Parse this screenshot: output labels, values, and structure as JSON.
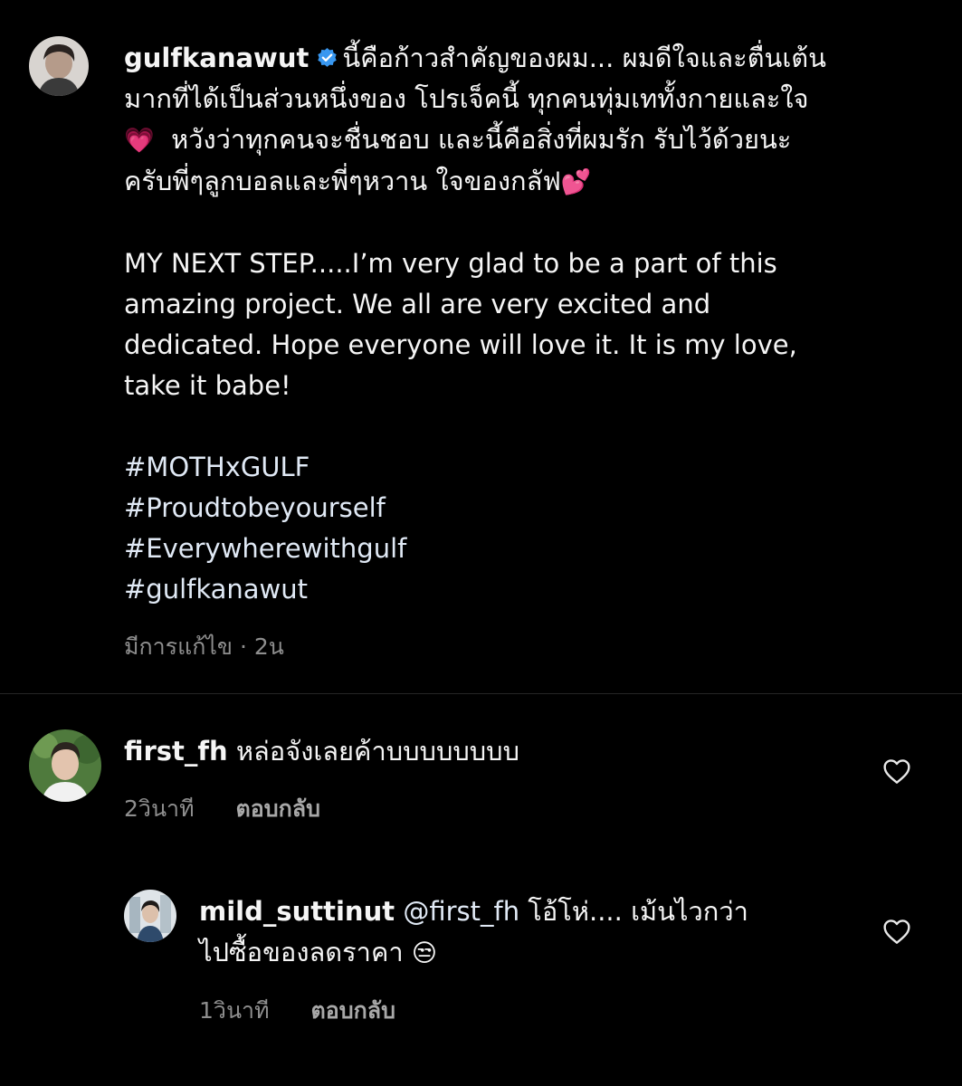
{
  "post": {
    "username": "gulfkanawut",
    "caption_lines": [
      "นี้คือก้าวสำคัญของผม... ผมดีใจและตื่นเต้น",
      "มากที่ได้เป็นส่วนหนึ่งของ โปรเจ็คนี้ ทุกคนทุ่มเททั้งกายและใจ",
      "หวังว่าทุกคนจะชื่นชอบ และนี้คือสิ่งที่ผมรัก รับไว้ด้วยนะ",
      "ครับพี่ๆลูกบอลและพี่ๆหวาน ใจของกลัฟ"
    ],
    "emoji_heart_pink": "💗",
    "emoji_two_hearts": "💕",
    "english_lines": [
      "MY NEXT STEP.....I’m very glad to be a part of this",
      "amazing project. We all are very excited and",
      "dedicated. Hope everyone will love it. It is my love,",
      "take it babe!"
    ],
    "hashtags": [
      "#MOTHxGULF",
      "#Proudtobeyourself",
      "#Everywherewithgulf",
      "#gulfkanawut"
    ],
    "meta_text": "มีการแก้ไข · 2น"
  },
  "comments": [
    {
      "username": "first_fh",
      "text": "หล่อจังเลยค้าบบบบบบบบ",
      "time": "2วินาที",
      "reply_label": "ตอบกลับ"
    },
    {
      "username": "mild_suttinut",
      "mention": "@first_fh",
      "text_line1": "โอ้โห่.... เม้นไวกว่า",
      "text_line2": "ไปซื้อของลดราคา",
      "emoji": "😒",
      "time": "1วินาที",
      "reply_label": "ตอบกลับ"
    }
  ],
  "colors": {
    "background": "#000000",
    "text": "#f5f5f5",
    "meta": "#8e8e8e",
    "verified": "#3897f0",
    "divider": "#262626"
  },
  "icons": [
    "verified-badge-icon",
    "heart-outline-icon"
  ]
}
